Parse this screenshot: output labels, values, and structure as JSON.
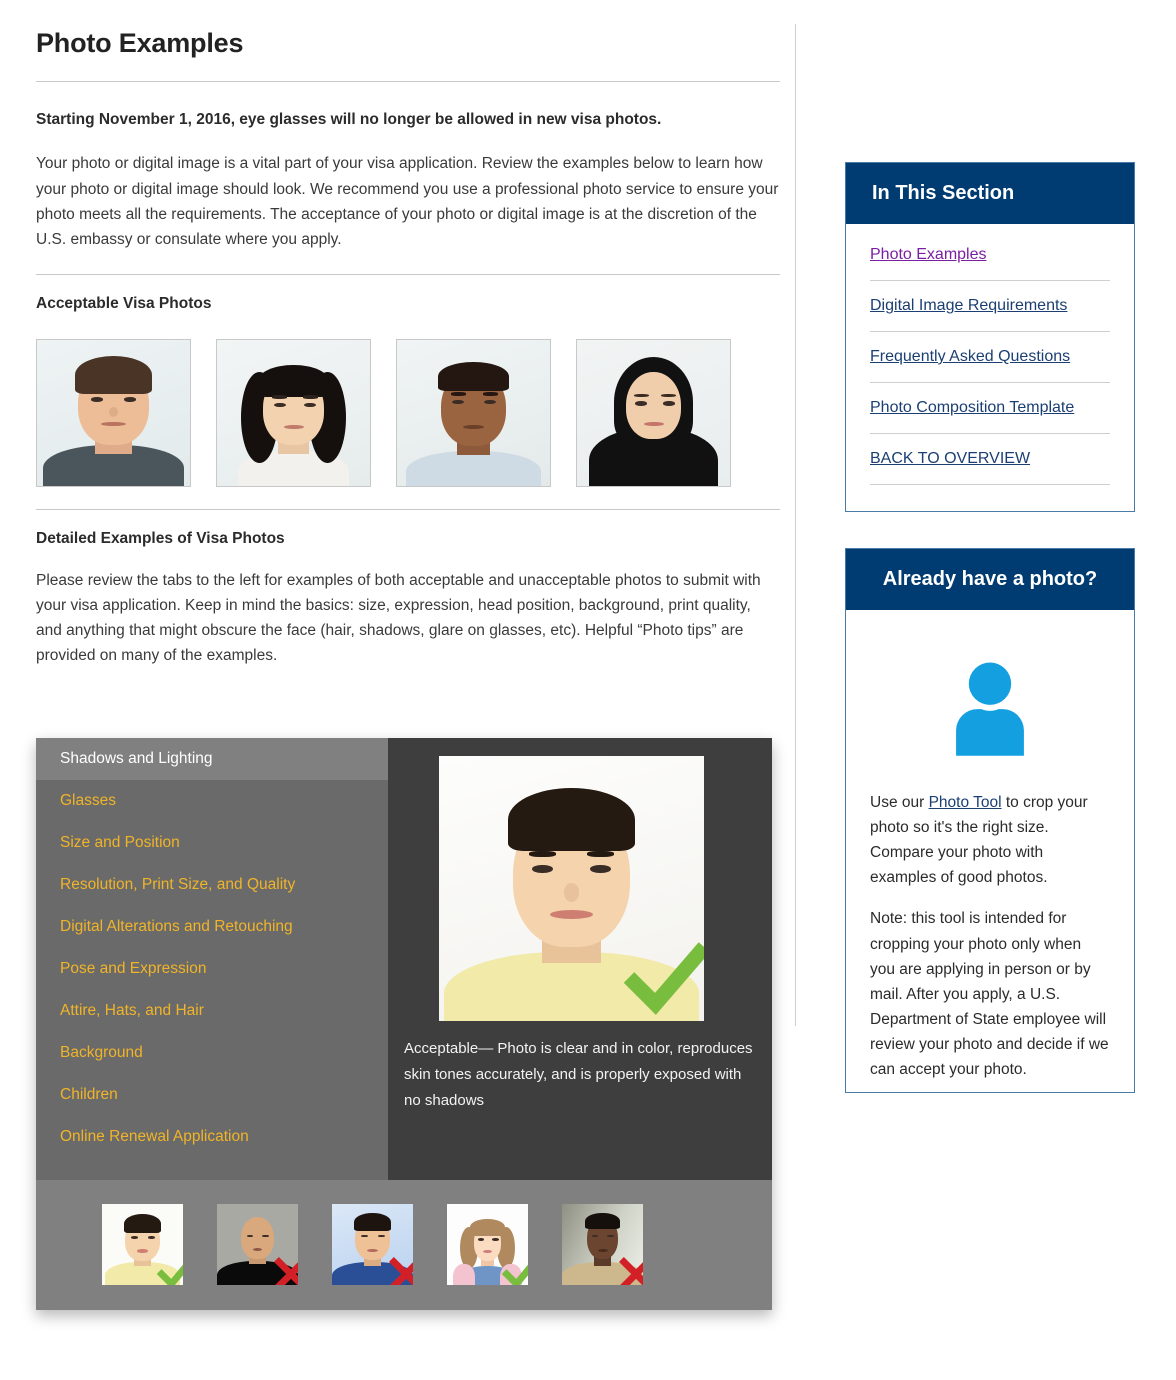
{
  "page": {
    "title": "Photo Examples",
    "lede": "Starting November 1, 2016, eye glasses will no longer be allowed in new visa photos.",
    "intro": "Your photo or digital image is a vital part of your visa application. Review the examples below to learn how your photo or digital image should look. We recommend you use a professional photo service to ensure your photo meets all the requirements. The acceptance of your photo or digital image is at the discretion of the U.S. embassy or consulate where you apply.",
    "acceptable_heading": "Acceptable Visa Photos",
    "detailed_heading": "Detailed Examples of Visa Photos",
    "detailed_intro": "Please review the tabs to the left for examples of both acceptable and unacceptable photos to submit with your visa application. Keep in mind the basics: size, expression, head position, background, print quality, and anything that might obscure the face (hair, shadows, glare on glasses, etc). Helpful “Photo tips” are provided on many of the examples."
  },
  "acceptable_photos": [
    {
      "alt": "Man with short brown hair in gray t-shirt"
    },
    {
      "alt": "Woman with long black hair in white top"
    },
    {
      "alt": "Man with short hair in light blue collared shirt"
    },
    {
      "alt": "Woman wearing black hijab"
    }
  ],
  "tabs": {
    "items": [
      {
        "label": "Shadows and Lighting",
        "active": true
      },
      {
        "label": "Glasses",
        "active": false
      },
      {
        "label": "Size and Position",
        "active": false
      },
      {
        "label": "Resolution, Print Size, and Quality",
        "active": false
      },
      {
        "label": "Digital Alterations and Retouching",
        "active": false
      },
      {
        "label": "Pose and Expression",
        "active": false
      },
      {
        "label": "Attire, Hats, and Hair",
        "active": false
      },
      {
        "label": "Background",
        "active": false
      },
      {
        "label": "Children",
        "active": false
      },
      {
        "label": "Online Renewal Application",
        "active": false
      }
    ],
    "panel": {
      "caption": "Acceptable— Photo is clear and in color, reproduces skin tones accurately, and is properly exposed with no shadows",
      "verdict": "acceptable",
      "photo_alt": "Man in pale yellow v-neck shirt on white background"
    },
    "thumbnails": [
      {
        "verdict": "acceptable",
        "alt": "Man in pale yellow shirt, white background"
      },
      {
        "verdict": "unacceptable",
        "alt": "Bald man in black shirt, gray background"
      },
      {
        "verdict": "unacceptable",
        "alt": "Man in blue shirt, blue tinted background"
      },
      {
        "verdict": "acceptable",
        "alt": "Young girl in pink and blue, white background"
      },
      {
        "verdict": "unacceptable",
        "alt": "Man in tan jacket, shadowed background"
      }
    ]
  },
  "in_this_section": {
    "title": "In This Section",
    "links": [
      {
        "label": "Photo Examples",
        "visited": true
      },
      {
        "label": "Digital Image Requirements",
        "visited": false
      },
      {
        "label": "Frequently Asked Questions",
        "visited": false
      },
      {
        "label": "Photo Composition Template",
        "visited": false
      },
      {
        "label": "BACK TO OVERVIEW",
        "visited": false
      }
    ]
  },
  "already_have_photo": {
    "title": "Already have a photo?",
    "icon": "person-icon",
    "paragraph1_before": "Use our ",
    "paragraph1_link": "Photo Tool",
    "paragraph1_after": " to crop your photo so it's the right size. Compare your photo with examples of good photos.",
    "paragraph2": "Note: this tool is intended for cropping your photo only when you are applying in person or by mail. After you apply, a U.S. Department of State employee will review your photo and decide if we can accept your photo."
  },
  "colors": {
    "header_blue": "#003b71",
    "card_border": "#4a7ba8",
    "link_blue": "#1b3f73",
    "link_visited": "#7b1fa2",
    "person_icon_blue": "#14a0e0",
    "tab_gold": "#f0b429",
    "tab_panel_dark": "#3e3e3e",
    "tab_list_gray": "#6a6a6a",
    "tab_active_gray": "#808080",
    "thumb_strip_gray": "#808080",
    "check_green": "#79bd3f",
    "cross_red": "#d32027"
  }
}
